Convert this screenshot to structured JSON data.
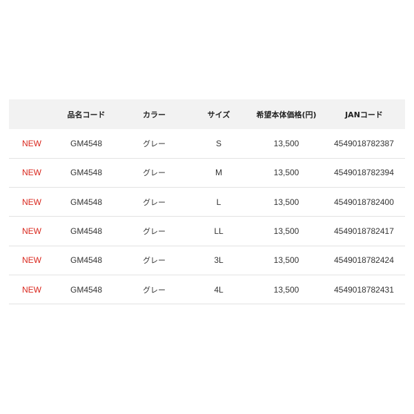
{
  "table": {
    "headers": [
      "",
      "品名コード",
      "カラー",
      "サイズ",
      "希望本体価格(円)",
      "JANコード"
    ],
    "rows": [
      {
        "badge": "NEW",
        "code": "GM4548",
        "color": "グレー",
        "size": "S",
        "price": "13,500",
        "jan": "4549018782387"
      },
      {
        "badge": "NEW",
        "code": "GM4548",
        "color": "グレー",
        "size": "M",
        "price": "13,500",
        "jan": "4549018782394"
      },
      {
        "badge": "NEW",
        "code": "GM4548",
        "color": "グレー",
        "size": "L",
        "price": "13,500",
        "jan": "4549018782400"
      },
      {
        "badge": "NEW",
        "code": "GM4548",
        "color": "グレー",
        "size": "LL",
        "price": "13,500",
        "jan": "4549018782417"
      },
      {
        "badge": "NEW",
        "code": "GM4548",
        "color": "グレー",
        "size": "3L",
        "price": "13,500",
        "jan": "4549018782424"
      },
      {
        "badge": "NEW",
        "code": "GM4548",
        "color": "グレー",
        "size": "4L",
        "price": "13,500",
        "jan": "4549018782431"
      }
    ]
  },
  "colors": {
    "badge": "#d9261c",
    "header_bg": "#f2f2f2",
    "divider": "#e2e2e2"
  }
}
